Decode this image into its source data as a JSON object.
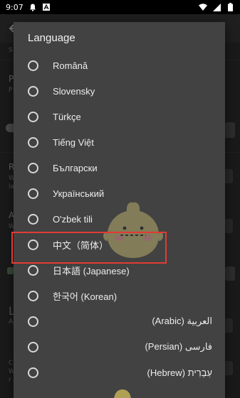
{
  "status_bar": {
    "time": "9:07",
    "icons_left": [
      "notification-bell-icon",
      "text-a-icon"
    ],
    "icons_right": [
      "wifi-icon",
      "signal-icon",
      "battery-icon"
    ]
  },
  "background": {
    "fragments": {
      "s1": "S",
      "p1": "P",
      "p2": "P",
      "r1": "R",
      "w1": "W",
      "l1": "la",
      "a1": "A",
      "w2": "W",
      "l2": "L",
      "ap": "Ap",
      "c1": "C",
      "w3": "W",
      "r2": "r"
    }
  },
  "dialog": {
    "title": "Language",
    "items": [
      {
        "label": "Română"
      },
      {
        "label": "Slovensky"
      },
      {
        "label": "Türkçe"
      },
      {
        "label": "Tiếng Việt"
      },
      {
        "label": "Български"
      },
      {
        "label": "Український"
      },
      {
        "label": "O'zbek tili"
      },
      {
        "label": "中文（简体）"
      },
      {
        "label": "日本語 (Japanese)"
      },
      {
        "label": "한국어 (Korean)"
      },
      {
        "label": "العربية (Arabic)"
      },
      {
        "label": "فارسی (Persian)"
      },
      {
        "label": "עִבְרִית (Hebrew)"
      }
    ],
    "highlighted_item": "中文（简体）",
    "highlight_color": "#e23b33"
  }
}
